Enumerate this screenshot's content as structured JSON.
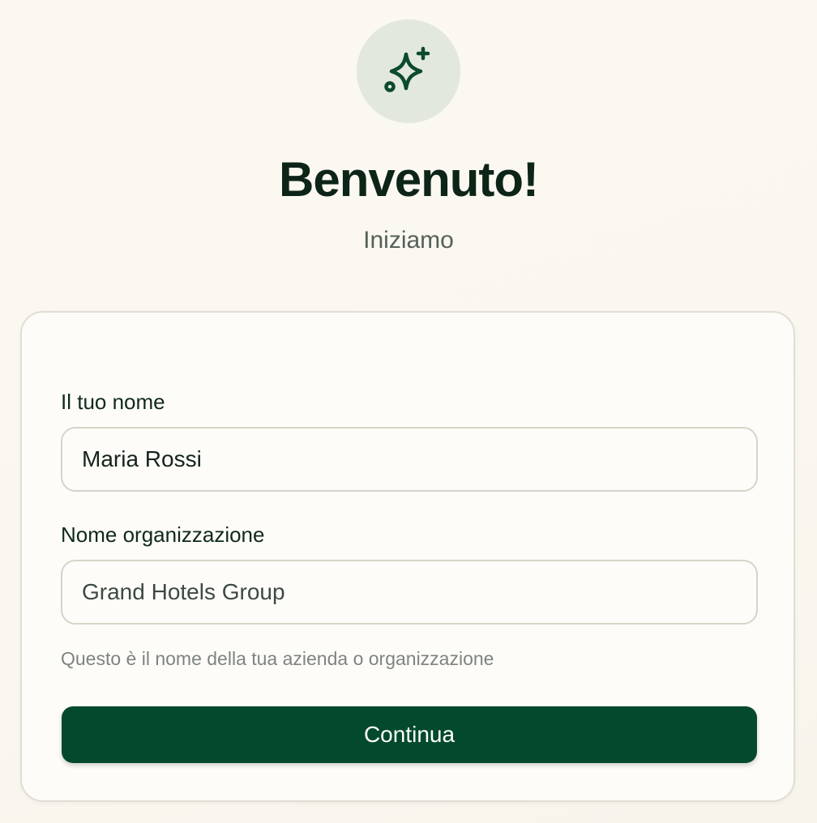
{
  "header": {
    "logo_icon": "sparkles-icon",
    "title": "Benvenuto!",
    "subtitle": "Iniziamo"
  },
  "form": {
    "name_label": "Il tuo nome",
    "name_value": "Maria Rossi",
    "org_label": "Nome organizzazione",
    "org_value": "Grand Hotels Group",
    "org_helper": "Questo è il nome della tua azienda o organizzazione",
    "continue_label": "Continua"
  },
  "colors": {
    "brand": "#034a2c",
    "icon_bg": "#e3e8df",
    "background": "#faf7f0"
  }
}
